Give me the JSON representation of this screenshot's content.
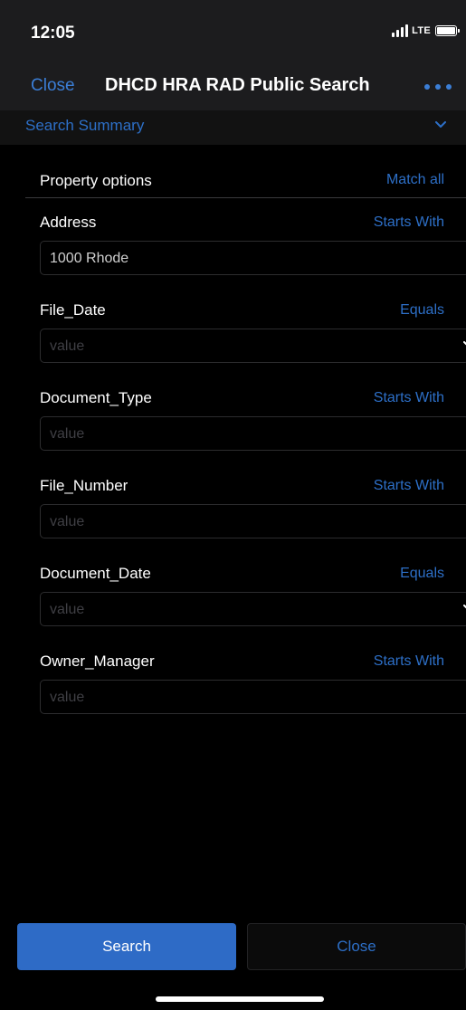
{
  "status_bar": {
    "time": "12:05",
    "network": "LTE",
    "icons": [
      "signal-bars-icon",
      "battery-icon"
    ]
  },
  "nav": {
    "close_label": "Close",
    "title": "DHCD HRA RAD Public Search",
    "more_icon": "more-dots-icon"
  },
  "summary": {
    "label": "Search Summary",
    "icon": "chevron-down-icon"
  },
  "options": {
    "label": "Property options",
    "match_label": "Match all"
  },
  "fields": [
    {
      "label": "Address",
      "operator": "Starts With",
      "value": "1000 Rhode",
      "placeholder": "value",
      "has_dropdown": false
    },
    {
      "label": "File_Date",
      "operator": "Equals",
      "value": "",
      "placeholder": "value",
      "has_dropdown": true
    },
    {
      "label": "Document_Type",
      "operator": "Starts With",
      "value": "",
      "placeholder": "value",
      "has_dropdown": false
    },
    {
      "label": "File_Number",
      "operator": "Starts With",
      "value": "",
      "placeholder": "value",
      "has_dropdown": false
    },
    {
      "label": "Document_Date",
      "operator": "Equals",
      "value": "",
      "placeholder": "value",
      "has_dropdown": true
    },
    {
      "label": "Owner_Manager",
      "operator": "Starts With",
      "value": "",
      "placeholder": "value",
      "has_dropdown": false
    }
  ],
  "buttons": {
    "search_label": "Search",
    "close_label": "Close"
  },
  "colors": {
    "accent": "#2d6fc7",
    "search_button": "#2e6bc6",
    "header_background": "#1c1c1e",
    "background": "#000000"
  }
}
